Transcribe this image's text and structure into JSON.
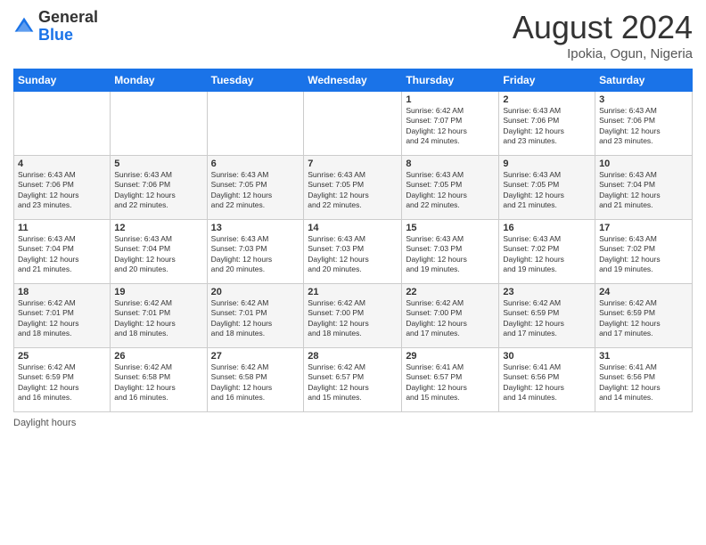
{
  "header": {
    "logo_general": "General",
    "logo_blue": "Blue",
    "month_year": "August 2024",
    "location": "Ipokia, Ogun, Nigeria"
  },
  "weekdays": [
    "Sunday",
    "Monday",
    "Tuesday",
    "Wednesday",
    "Thursday",
    "Friday",
    "Saturday"
  ],
  "weeks": [
    [
      {
        "day": "",
        "info": ""
      },
      {
        "day": "",
        "info": ""
      },
      {
        "day": "",
        "info": ""
      },
      {
        "day": "",
        "info": ""
      },
      {
        "day": "1",
        "info": "Sunrise: 6:42 AM\nSunset: 7:07 PM\nDaylight: 12 hours\nand 24 minutes."
      },
      {
        "day": "2",
        "info": "Sunrise: 6:43 AM\nSunset: 7:06 PM\nDaylight: 12 hours\nand 23 minutes."
      },
      {
        "day": "3",
        "info": "Sunrise: 6:43 AM\nSunset: 7:06 PM\nDaylight: 12 hours\nand 23 minutes."
      }
    ],
    [
      {
        "day": "4",
        "info": "Sunrise: 6:43 AM\nSunset: 7:06 PM\nDaylight: 12 hours\nand 23 minutes."
      },
      {
        "day": "5",
        "info": "Sunrise: 6:43 AM\nSunset: 7:06 PM\nDaylight: 12 hours\nand 22 minutes."
      },
      {
        "day": "6",
        "info": "Sunrise: 6:43 AM\nSunset: 7:05 PM\nDaylight: 12 hours\nand 22 minutes."
      },
      {
        "day": "7",
        "info": "Sunrise: 6:43 AM\nSunset: 7:05 PM\nDaylight: 12 hours\nand 22 minutes."
      },
      {
        "day": "8",
        "info": "Sunrise: 6:43 AM\nSunset: 7:05 PM\nDaylight: 12 hours\nand 22 minutes."
      },
      {
        "day": "9",
        "info": "Sunrise: 6:43 AM\nSunset: 7:05 PM\nDaylight: 12 hours\nand 21 minutes."
      },
      {
        "day": "10",
        "info": "Sunrise: 6:43 AM\nSunset: 7:04 PM\nDaylight: 12 hours\nand 21 minutes."
      }
    ],
    [
      {
        "day": "11",
        "info": "Sunrise: 6:43 AM\nSunset: 7:04 PM\nDaylight: 12 hours\nand 21 minutes."
      },
      {
        "day": "12",
        "info": "Sunrise: 6:43 AM\nSunset: 7:04 PM\nDaylight: 12 hours\nand 20 minutes."
      },
      {
        "day": "13",
        "info": "Sunrise: 6:43 AM\nSunset: 7:03 PM\nDaylight: 12 hours\nand 20 minutes."
      },
      {
        "day": "14",
        "info": "Sunrise: 6:43 AM\nSunset: 7:03 PM\nDaylight: 12 hours\nand 20 minutes."
      },
      {
        "day": "15",
        "info": "Sunrise: 6:43 AM\nSunset: 7:03 PM\nDaylight: 12 hours\nand 19 minutes."
      },
      {
        "day": "16",
        "info": "Sunrise: 6:43 AM\nSunset: 7:02 PM\nDaylight: 12 hours\nand 19 minutes."
      },
      {
        "day": "17",
        "info": "Sunrise: 6:43 AM\nSunset: 7:02 PM\nDaylight: 12 hours\nand 19 minutes."
      }
    ],
    [
      {
        "day": "18",
        "info": "Sunrise: 6:42 AM\nSunset: 7:01 PM\nDaylight: 12 hours\nand 18 minutes."
      },
      {
        "day": "19",
        "info": "Sunrise: 6:42 AM\nSunset: 7:01 PM\nDaylight: 12 hours\nand 18 minutes."
      },
      {
        "day": "20",
        "info": "Sunrise: 6:42 AM\nSunset: 7:01 PM\nDaylight: 12 hours\nand 18 minutes."
      },
      {
        "day": "21",
        "info": "Sunrise: 6:42 AM\nSunset: 7:00 PM\nDaylight: 12 hours\nand 18 minutes."
      },
      {
        "day": "22",
        "info": "Sunrise: 6:42 AM\nSunset: 7:00 PM\nDaylight: 12 hours\nand 17 minutes."
      },
      {
        "day": "23",
        "info": "Sunrise: 6:42 AM\nSunset: 6:59 PM\nDaylight: 12 hours\nand 17 minutes."
      },
      {
        "day": "24",
        "info": "Sunrise: 6:42 AM\nSunset: 6:59 PM\nDaylight: 12 hours\nand 17 minutes."
      }
    ],
    [
      {
        "day": "25",
        "info": "Sunrise: 6:42 AM\nSunset: 6:59 PM\nDaylight: 12 hours\nand 16 minutes."
      },
      {
        "day": "26",
        "info": "Sunrise: 6:42 AM\nSunset: 6:58 PM\nDaylight: 12 hours\nand 16 minutes."
      },
      {
        "day": "27",
        "info": "Sunrise: 6:42 AM\nSunset: 6:58 PM\nDaylight: 12 hours\nand 16 minutes."
      },
      {
        "day": "28",
        "info": "Sunrise: 6:42 AM\nSunset: 6:57 PM\nDaylight: 12 hours\nand 15 minutes."
      },
      {
        "day": "29",
        "info": "Sunrise: 6:41 AM\nSunset: 6:57 PM\nDaylight: 12 hours\nand 15 minutes."
      },
      {
        "day": "30",
        "info": "Sunrise: 6:41 AM\nSunset: 6:56 PM\nDaylight: 12 hours\nand 14 minutes."
      },
      {
        "day": "31",
        "info": "Sunrise: 6:41 AM\nSunset: 6:56 PM\nDaylight: 12 hours\nand 14 minutes."
      }
    ]
  ],
  "footer": {
    "daylight_label": "Daylight hours"
  }
}
